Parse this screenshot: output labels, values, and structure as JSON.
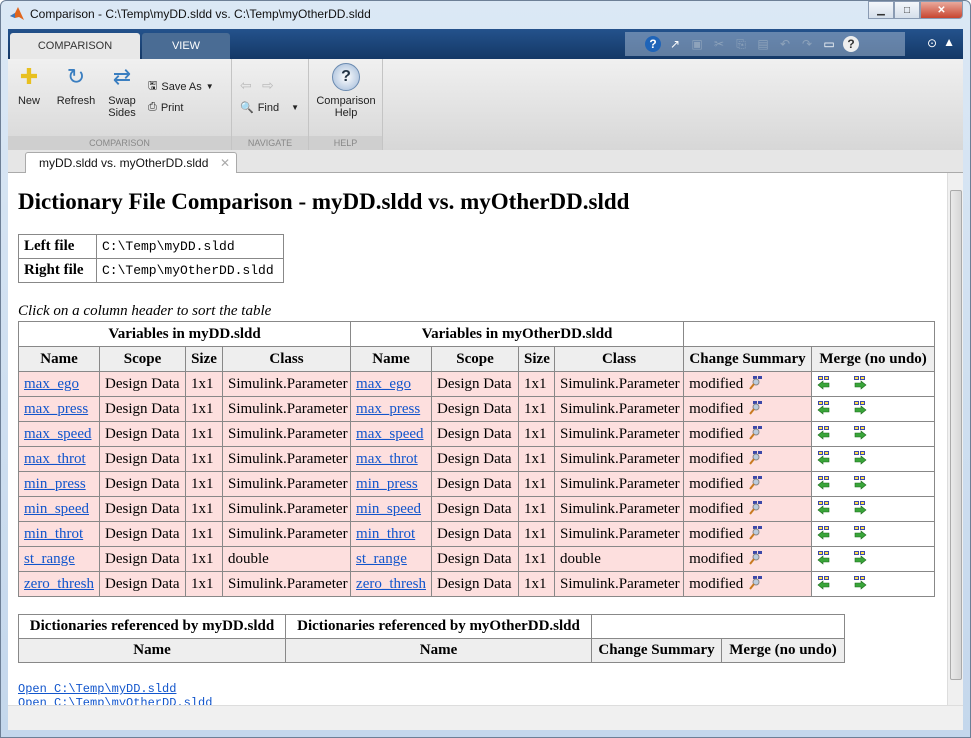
{
  "window": {
    "title": "Comparison - C:\\Temp\\myDD.sldd vs. C:\\Temp\\myOtherDD.sldd"
  },
  "ribbon": {
    "tabs": [
      {
        "label": "COMPARISON",
        "active": true
      },
      {
        "label": "VIEW",
        "active": false
      }
    ],
    "groups": {
      "comparison": "COMPARISON",
      "navigate": "NAVIGATE",
      "help": "HELP"
    },
    "buttons": {
      "new": "New",
      "refresh": "Refresh",
      "swap_line1": "Swap",
      "swap_line2": "Sides",
      "save_as": "Save As",
      "print": "Print",
      "find": "Find",
      "help_line1": "Comparison",
      "help_line2": "Help"
    }
  },
  "doc_tab": {
    "label": "myDD.sldd vs. myOtherDD.sldd"
  },
  "report": {
    "title": "Dictionary File Comparison - myDD.sldd vs. myOtherDD.sldd",
    "files": {
      "left_label": "Left file",
      "left_value": "C:\\Temp\\myDD.sldd",
      "right_label": "Right file",
      "right_value": "C:\\Temp\\myOtherDD.sldd"
    },
    "hint": "Click on a column header to sort the table",
    "variables": {
      "left_group": "Variables in myDD.sldd",
      "right_group": "Variables in myOtherDD.sldd",
      "columns": [
        "Name",
        "Scope",
        "Size",
        "Class",
        "Name",
        "Scope",
        "Size",
        "Class",
        "Change Summary",
        "Merge (no undo)"
      ],
      "rows": [
        [
          "max_ego",
          "Design Data",
          "1x1",
          "Simulink.Parameter",
          "max_ego",
          "Design Data",
          "1x1",
          "Simulink.Parameter",
          "modified"
        ],
        [
          "max_press",
          "Design Data",
          "1x1",
          "Simulink.Parameter",
          "max_press",
          "Design Data",
          "1x1",
          "Simulink.Parameter",
          "modified"
        ],
        [
          "max_speed",
          "Design Data",
          "1x1",
          "Simulink.Parameter",
          "max_speed",
          "Design Data",
          "1x1",
          "Simulink.Parameter",
          "modified"
        ],
        [
          "max_throt",
          "Design Data",
          "1x1",
          "Simulink.Parameter",
          "max_throt",
          "Design Data",
          "1x1",
          "Simulink.Parameter",
          "modified"
        ],
        [
          "min_press",
          "Design Data",
          "1x1",
          "Simulink.Parameter",
          "min_press",
          "Design Data",
          "1x1",
          "Simulink.Parameter",
          "modified"
        ],
        [
          "min_speed",
          "Design Data",
          "1x1",
          "Simulink.Parameter",
          "min_speed",
          "Design Data",
          "1x1",
          "Simulink.Parameter",
          "modified"
        ],
        [
          "min_throt",
          "Design Data",
          "1x1",
          "Simulink.Parameter",
          "min_throt",
          "Design Data",
          "1x1",
          "Simulink.Parameter",
          "modified"
        ],
        [
          "st_range",
          "Design Data",
          "1x1",
          "double",
          "st_range",
          "Design Data",
          "1x1",
          "double",
          "modified"
        ],
        [
          "zero_thresh",
          "Design Data",
          "1x1",
          "Simulink.Parameter",
          "zero_thresh",
          "Design Data",
          "1x1",
          "Simulink.Parameter",
          "modified"
        ]
      ]
    },
    "references": {
      "left_group": "Dictionaries referenced by myDD.sldd",
      "right_group": "Dictionaries referenced by myOtherDD.sldd",
      "columns": [
        "Name",
        "Name",
        "Change Summary",
        "Merge (no undo)"
      ]
    },
    "links": [
      "Open C:\\Temp\\myDD.sldd",
      "Open C:\\Temp\\myOtherDD.sldd"
    ]
  },
  "colors": {
    "diff_row": "#fddfde",
    "link": "#1155cc",
    "ribbon_tab_bar": "#1c3e6c"
  }
}
